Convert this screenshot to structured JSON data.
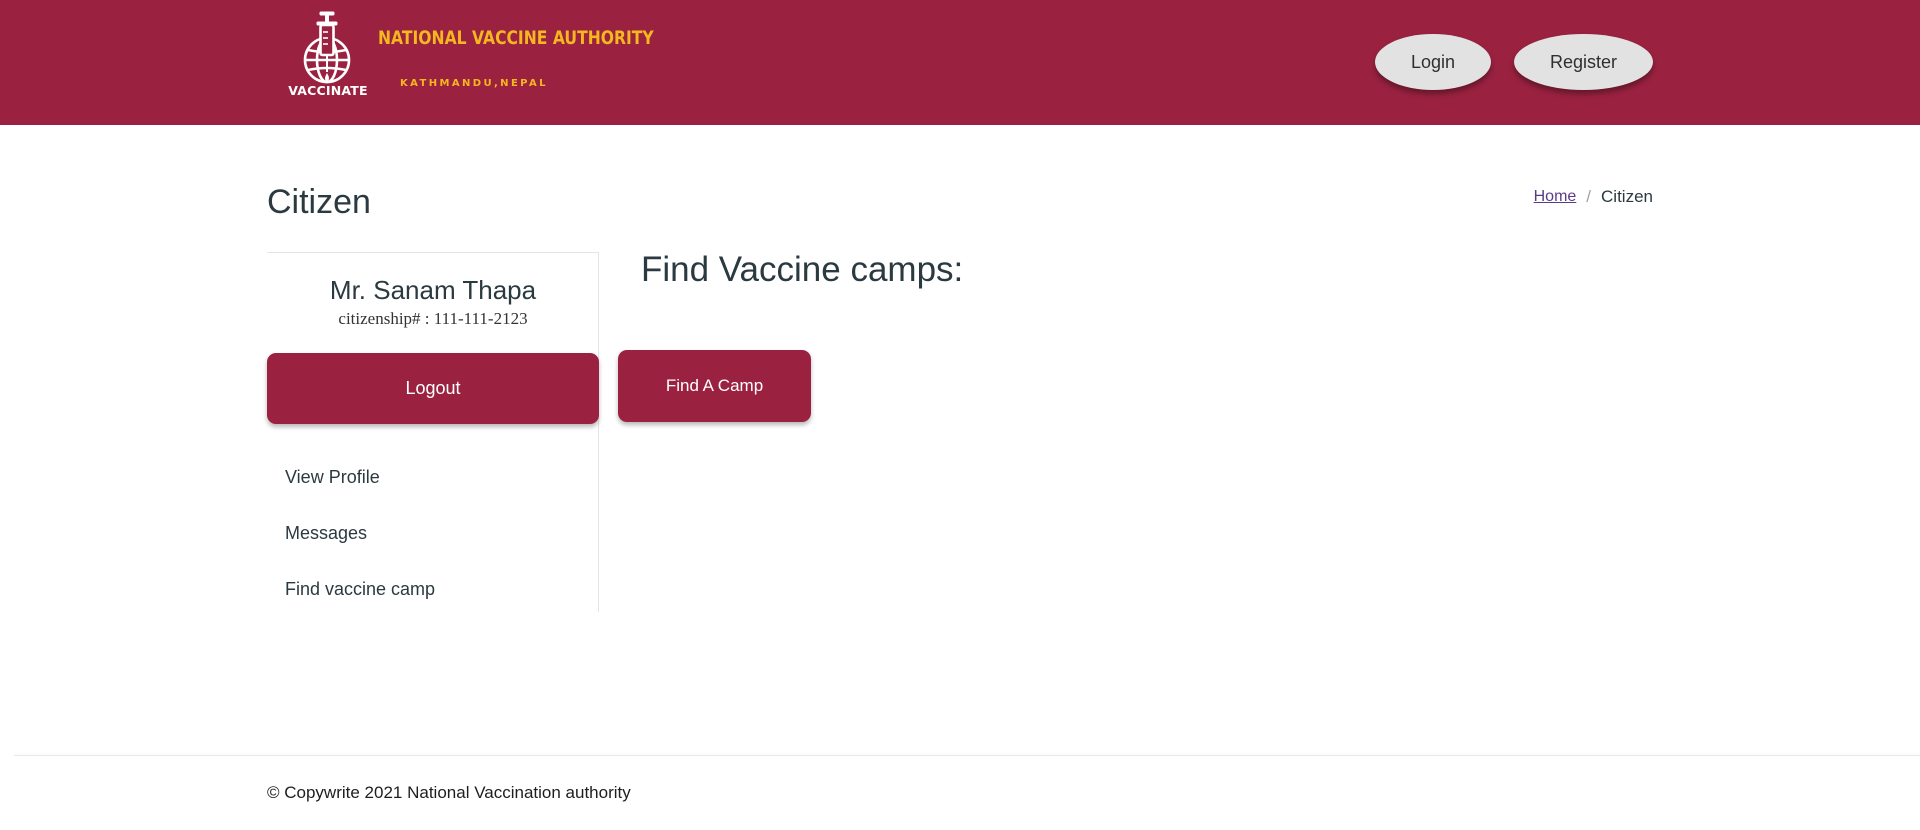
{
  "header": {
    "logo_word": "VACCINATE",
    "brand_title": "NATIONAL VACCINE AUTHORITY",
    "brand_subtitle": "KATHMANDU,NEPAL",
    "login_label": "Login",
    "register_label": "Register",
    "colors": {
      "brand": "#9a2240",
      "accent": "#f5b71f",
      "pill": "#e2e2e2"
    }
  },
  "page": {
    "title": "Citizen",
    "breadcrumb": {
      "home": "Home",
      "separator": "/",
      "current": "Citizen"
    }
  },
  "sidebar": {
    "user_name": "Mr. Sanam Thapa",
    "citizenship": "citizenship# : 111-111-2123",
    "logout_label": "Logout",
    "items": [
      {
        "label": "View Profile"
      },
      {
        "label": "Messages"
      },
      {
        "label": "Find vaccine camp"
      }
    ]
  },
  "main": {
    "heading": "Find Vaccine camps:",
    "find_camp_label": "Find A Camp"
  },
  "footer": {
    "text": "© Copywrite 2021 National Vaccination authority"
  },
  "icons": {
    "logo": "globe-syringe-icon"
  }
}
